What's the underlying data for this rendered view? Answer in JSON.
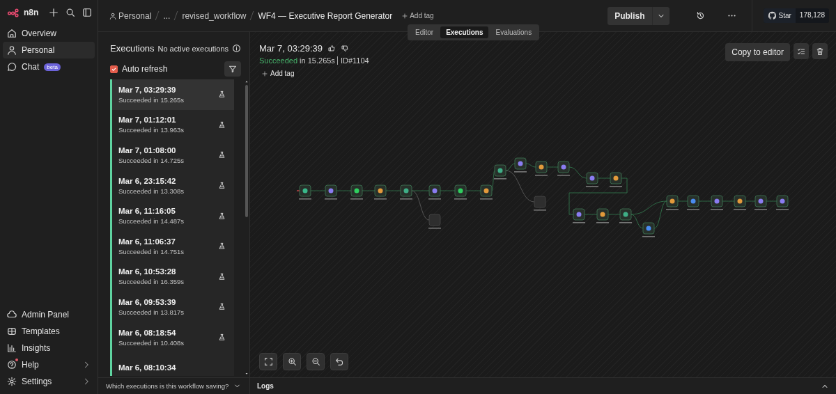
{
  "sidebar": {
    "logo": "n8n",
    "items": [
      {
        "label": "Overview",
        "selected": false
      },
      {
        "label": "Personal",
        "selected": true
      },
      {
        "label": "Chat",
        "selected": false,
        "badge": "beta"
      }
    ],
    "bottom_items": [
      {
        "label": "Admin Panel",
        "chevron": false,
        "notification": false
      },
      {
        "label": "Templates",
        "chevron": false,
        "notification": false
      },
      {
        "label": "Insights",
        "chevron": false,
        "notification": false
      },
      {
        "label": "Help",
        "chevron": true,
        "notification": true
      },
      {
        "label": "Settings",
        "chevron": true,
        "notification": false
      }
    ]
  },
  "header": {
    "breadcrumbs": [
      "Personal",
      "...",
      "revised_workflow"
    ],
    "title": "WF4 — Executive Report Generator",
    "add_tag": "Add tag",
    "publish": "Publish",
    "github": {
      "label": "Star",
      "count": "178,128"
    }
  },
  "view_tabs": [
    {
      "label": "Editor",
      "selected": false
    },
    {
      "label": "Executions",
      "selected": true
    },
    {
      "label": "Evaluations",
      "selected": false
    }
  ],
  "executions": {
    "title": "Executions",
    "status": "No active executions",
    "auto_refresh": {
      "label": "Auto refresh",
      "checked": true
    },
    "items": [
      {
        "time": "Mar 7, 03:29:39",
        "status": "Succeeded in 15.265s",
        "selected": true
      },
      {
        "time": "Mar 7, 01:12:01",
        "status": "Succeeded in 13.963s",
        "selected": false
      },
      {
        "time": "Mar 7, 01:08:00",
        "status": "Succeeded in 14.725s",
        "selected": false
      },
      {
        "time": "Mar 6, 23:15:42",
        "status": "Succeeded in 13.308s",
        "selected": false
      },
      {
        "time": "Mar 6, 11:16:05",
        "status": "Succeeded in 14.487s",
        "selected": false
      },
      {
        "time": "Mar 6, 11:06:37",
        "status": "Succeeded in 14.751s",
        "selected": false
      },
      {
        "time": "Mar 6, 10:53:28",
        "status": "Succeeded in 16.359s",
        "selected": false
      },
      {
        "time": "Mar 6, 09:53:39",
        "status": "Succeeded in 13.817s",
        "selected": false
      },
      {
        "time": "Mar 6, 08:18:54",
        "status": "Succeeded in 10.408s",
        "selected": false
      },
      {
        "time": "Mar 6, 08:10:34",
        "selected": false
      }
    ],
    "saving_question": "Which executions is this workflow saving?"
  },
  "detail": {
    "time": "Mar 7, 03:29:39",
    "result": "Succeeded",
    "duration": "in 15.265s",
    "id": "ID#1104",
    "add_tag": "Add tag",
    "copy_button": "Copy to editor"
  },
  "logs": "Logs"
}
